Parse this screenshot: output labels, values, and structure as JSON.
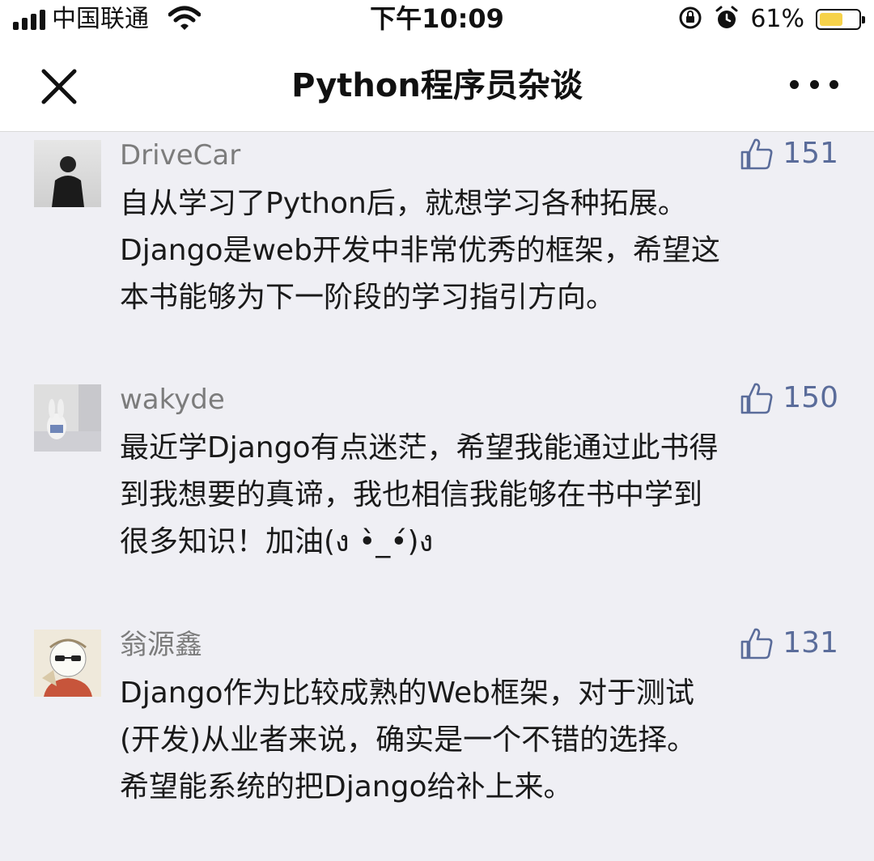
{
  "status_bar": {
    "carrier": "中国联通",
    "time": "下午10:09",
    "battery_percent": "61%",
    "battery_level": 0.61,
    "battery_color": "#f6d24a"
  },
  "nav": {
    "title": "Python程序员杂谈",
    "close_icon": "close-icon",
    "more_icon": "more-icon"
  },
  "comments": [
    {
      "user": "DriveCar",
      "likes": "151",
      "text": "自从学习了Python后，就想学习各种拓展。\nDjango是web开发中非常优秀的框架，希望这\n本书能够为下一阶段的学习指引方向。"
    },
    {
      "user": "wakyde",
      "likes": "150",
      "text": "最近学Django有点迷茫，希望我能通过此书得\n到我想要的真谛，我也相信我能够在书中学到\n很多知识！加油(ง •̀_•́)ง"
    },
    {
      "user": "翁源鑫",
      "likes": "131",
      "text": "Django作为比较成熟的Web框架，对于测试\n(开发)从业者来说，确实是一个不错的选择。\n希望能系统的把Django给补上来。"
    }
  ],
  "colors": {
    "like_color": "#5a6c9a",
    "username_color": "#7c7c7c",
    "background": "#efeff4"
  }
}
